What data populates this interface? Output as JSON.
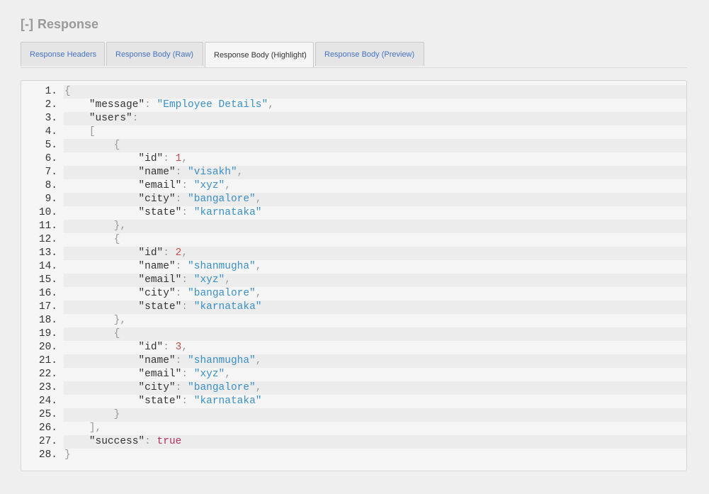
{
  "section": {
    "toggle": "[-]",
    "title": "Response"
  },
  "tabs": [
    {
      "label": "Response Headers",
      "active": false
    },
    {
      "label": "Response Body (Raw)",
      "active": false
    },
    {
      "label": "Response Body (Highlight)",
      "active": true
    },
    {
      "label": "Response Body (Preview)",
      "active": false
    }
  ],
  "code": {
    "line_numbers": [
      "1.",
      "2.",
      "3.",
      "4.",
      "5.",
      "6.",
      "7.",
      "8.",
      "9.",
      "10.",
      "11.",
      "12.",
      "13.",
      "14.",
      "15.",
      "16.",
      "17.",
      "18.",
      "19.",
      "20.",
      "21.",
      "22.",
      "23.",
      "24.",
      "25.",
      "26.",
      "27.",
      "28."
    ],
    "lines": [
      [
        {
          "t": "{",
          "c": "p"
        }
      ],
      [
        {
          "t": "    ",
          "c": "k"
        },
        {
          "t": "\"message\"",
          "c": "k"
        },
        {
          "t": ": ",
          "c": "p"
        },
        {
          "t": "\"Employee Details\"",
          "c": "s"
        },
        {
          "t": ",",
          "c": "p"
        }
      ],
      [
        {
          "t": "    ",
          "c": "k"
        },
        {
          "t": "\"users\"",
          "c": "k"
        },
        {
          "t": ":",
          "c": "p"
        }
      ],
      [
        {
          "t": "    ",
          "c": "k"
        },
        {
          "t": "[",
          "c": "p"
        }
      ],
      [
        {
          "t": "        ",
          "c": "k"
        },
        {
          "t": "{",
          "c": "p"
        }
      ],
      [
        {
          "t": "            ",
          "c": "k"
        },
        {
          "t": "\"id\"",
          "c": "k"
        },
        {
          "t": ": ",
          "c": "p"
        },
        {
          "t": "1",
          "c": "n"
        },
        {
          "t": ",",
          "c": "p"
        }
      ],
      [
        {
          "t": "            ",
          "c": "k"
        },
        {
          "t": "\"name\"",
          "c": "k"
        },
        {
          "t": ": ",
          "c": "p"
        },
        {
          "t": "\"visakh\"",
          "c": "s"
        },
        {
          "t": ",",
          "c": "p"
        }
      ],
      [
        {
          "t": "            ",
          "c": "k"
        },
        {
          "t": "\"email\"",
          "c": "k"
        },
        {
          "t": ": ",
          "c": "p"
        },
        {
          "t": "\"xyz\"",
          "c": "s"
        },
        {
          "t": ",",
          "c": "p"
        }
      ],
      [
        {
          "t": "            ",
          "c": "k"
        },
        {
          "t": "\"city\"",
          "c": "k"
        },
        {
          "t": ": ",
          "c": "p"
        },
        {
          "t": "\"bangalore\"",
          "c": "s"
        },
        {
          "t": ",",
          "c": "p"
        }
      ],
      [
        {
          "t": "            ",
          "c": "k"
        },
        {
          "t": "\"state\"",
          "c": "k"
        },
        {
          "t": ": ",
          "c": "p"
        },
        {
          "t": "\"karnataka\"",
          "c": "s"
        }
      ],
      [
        {
          "t": "        ",
          "c": "k"
        },
        {
          "t": "},",
          "c": "p"
        }
      ],
      [
        {
          "t": "        ",
          "c": "k"
        },
        {
          "t": "{",
          "c": "p"
        }
      ],
      [
        {
          "t": "            ",
          "c": "k"
        },
        {
          "t": "\"id\"",
          "c": "k"
        },
        {
          "t": ": ",
          "c": "p"
        },
        {
          "t": "2",
          "c": "n"
        },
        {
          "t": ",",
          "c": "p"
        }
      ],
      [
        {
          "t": "            ",
          "c": "k"
        },
        {
          "t": "\"name\"",
          "c": "k"
        },
        {
          "t": ": ",
          "c": "p"
        },
        {
          "t": "\"shanmugha\"",
          "c": "s"
        },
        {
          "t": ",",
          "c": "p"
        }
      ],
      [
        {
          "t": "            ",
          "c": "k"
        },
        {
          "t": "\"email\"",
          "c": "k"
        },
        {
          "t": ": ",
          "c": "p"
        },
        {
          "t": "\"xyz\"",
          "c": "s"
        },
        {
          "t": ",",
          "c": "p"
        }
      ],
      [
        {
          "t": "            ",
          "c": "k"
        },
        {
          "t": "\"city\"",
          "c": "k"
        },
        {
          "t": ": ",
          "c": "p"
        },
        {
          "t": "\"bangalore\"",
          "c": "s"
        },
        {
          "t": ",",
          "c": "p"
        }
      ],
      [
        {
          "t": "            ",
          "c": "k"
        },
        {
          "t": "\"state\"",
          "c": "k"
        },
        {
          "t": ": ",
          "c": "p"
        },
        {
          "t": "\"karnataka\"",
          "c": "s"
        }
      ],
      [
        {
          "t": "        ",
          "c": "k"
        },
        {
          "t": "},",
          "c": "p"
        }
      ],
      [
        {
          "t": "        ",
          "c": "k"
        },
        {
          "t": "{",
          "c": "p"
        }
      ],
      [
        {
          "t": "            ",
          "c": "k"
        },
        {
          "t": "\"id\"",
          "c": "k"
        },
        {
          "t": ": ",
          "c": "p"
        },
        {
          "t": "3",
          "c": "n"
        },
        {
          "t": ",",
          "c": "p"
        }
      ],
      [
        {
          "t": "            ",
          "c": "k"
        },
        {
          "t": "\"name\"",
          "c": "k"
        },
        {
          "t": ": ",
          "c": "p"
        },
        {
          "t": "\"shanmugha\"",
          "c": "s"
        },
        {
          "t": ",",
          "c": "p"
        }
      ],
      [
        {
          "t": "            ",
          "c": "k"
        },
        {
          "t": "\"email\"",
          "c": "k"
        },
        {
          "t": ": ",
          "c": "p"
        },
        {
          "t": "\"xyz\"",
          "c": "s"
        },
        {
          "t": ",",
          "c": "p"
        }
      ],
      [
        {
          "t": "            ",
          "c": "k"
        },
        {
          "t": "\"city\"",
          "c": "k"
        },
        {
          "t": ": ",
          "c": "p"
        },
        {
          "t": "\"bangalore\"",
          "c": "s"
        },
        {
          "t": ",",
          "c": "p"
        }
      ],
      [
        {
          "t": "            ",
          "c": "k"
        },
        {
          "t": "\"state\"",
          "c": "k"
        },
        {
          "t": ": ",
          "c": "p"
        },
        {
          "t": "\"karnataka\"",
          "c": "s"
        }
      ],
      [
        {
          "t": "        ",
          "c": "k"
        },
        {
          "t": "}",
          "c": "p"
        }
      ],
      [
        {
          "t": "    ",
          "c": "k"
        },
        {
          "t": "],",
          "c": "p"
        }
      ],
      [
        {
          "t": "    ",
          "c": "k"
        },
        {
          "t": "\"success\"",
          "c": "k"
        },
        {
          "t": ": ",
          "c": "p"
        },
        {
          "t": "true",
          "c": "b"
        }
      ],
      [
        {
          "t": "}",
          "c": "p"
        }
      ]
    ]
  }
}
